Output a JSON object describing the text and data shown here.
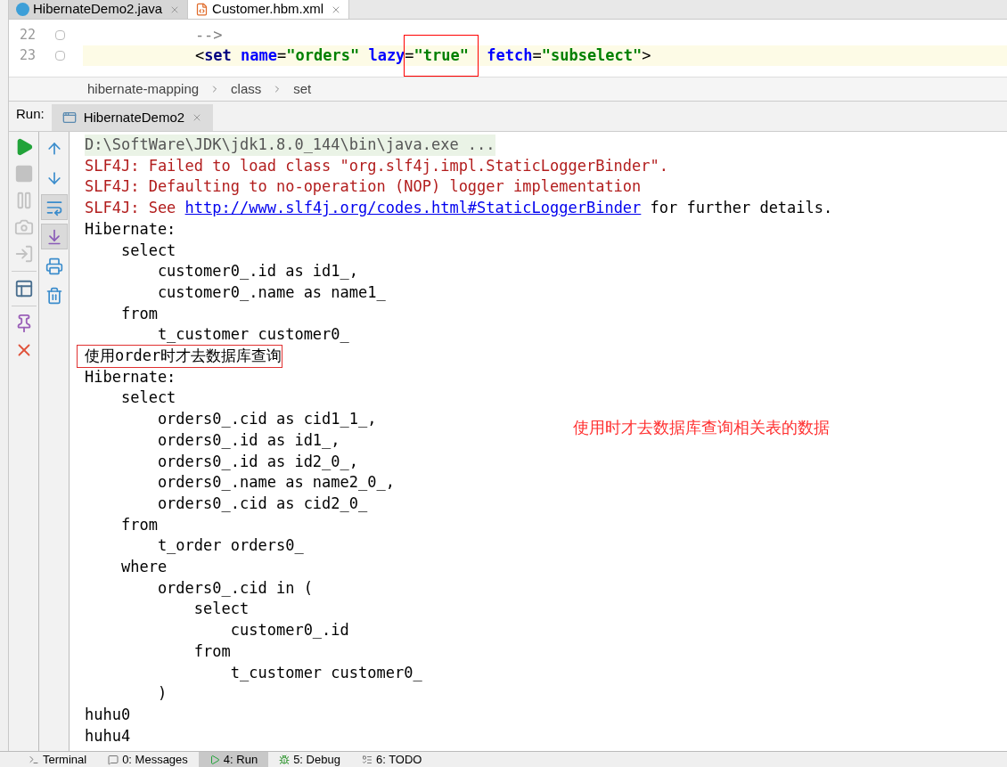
{
  "editor_tabs": [
    {
      "label": "HibernateDemo2.java",
      "kind": "java",
      "selected": false
    },
    {
      "label": "Customer.hbm.xml",
      "kind": "xml",
      "selected": true
    }
  ],
  "editor": {
    "lines": [
      {
        "number": "22",
        "current": false,
        "tokens": [
          {
            "kind": "comment",
            "text": "        -->"
          }
        ]
      },
      {
        "number": "23",
        "current": true,
        "tokens": [
          {
            "kind": "plain",
            "text": "        <"
          },
          {
            "kind": "tag",
            "text": "set"
          },
          {
            "kind": "attr",
            "text": " name"
          },
          {
            "kind": "plain",
            "text": "="
          },
          {
            "kind": "value",
            "text": "\"orders\""
          },
          {
            "kind": "attr",
            "text": " lazy"
          },
          {
            "kind": "group",
            "boxed": true,
            "tokens": [
              {
                "kind": "plain",
                "text": "="
              },
              {
                "kind": "value",
                "text": "\"true\""
              }
            ]
          },
          {
            "kind": "attr",
            "text": " fetch"
          },
          {
            "kind": "plain",
            "text": "="
          },
          {
            "kind": "value",
            "text": "\"subselect\""
          },
          {
            "kind": "plain",
            "text": ">"
          }
        ]
      }
    ]
  },
  "breadcrumb": [
    "hibernate-mapping",
    "class",
    "set"
  ],
  "run_panel": {
    "label": "Run:",
    "tab": "HibernateDemo2"
  },
  "toolbar_left": [
    {
      "kind": "run",
      "disabled": false
    },
    {
      "kind": "stop",
      "disabled": true
    },
    {
      "kind": "pause",
      "disabled": true
    },
    {
      "kind": "camera",
      "disabled": true
    },
    {
      "kind": "exit",
      "disabled": true
    },
    {
      "kind": "layout",
      "disabled": false
    },
    {
      "kind": "pin",
      "disabled": false
    },
    {
      "kind": "close",
      "disabled": false
    }
  ],
  "toolbar_right": [
    {
      "kind": "up",
      "on": false
    },
    {
      "kind": "down",
      "on": false
    },
    {
      "kind": "wrap",
      "on": true
    },
    {
      "kind": "scroll",
      "on": true
    },
    {
      "kind": "print",
      "on": false
    },
    {
      "kind": "trash",
      "on": false
    }
  ],
  "console": [
    {
      "kind": "command",
      "text": "D:\\SoftWare\\JDK\\jdk1.8.0_144\\bin\\java.exe ..."
    },
    {
      "kind": "error",
      "text": "SLF4J: Failed to load class \"org.slf4j.impl.StaticLoggerBinder\"."
    },
    {
      "kind": "error",
      "text": "SLF4J: Defaulting to no-operation (NOP) logger implementation"
    },
    {
      "kind": "link",
      "text": "SLF4J: See ",
      "link": "http://www.slf4j.org/codes.html#StaticLoggerBinder",
      "after": " for further details."
    },
    {
      "kind": "output",
      "text": "Hibernate: "
    },
    {
      "kind": "output",
      "text": "    select"
    },
    {
      "kind": "output",
      "text": "        customer0_.id as id1_,"
    },
    {
      "kind": "output",
      "text": "        customer0_.name as name1_ "
    },
    {
      "kind": "output",
      "text": "    from"
    },
    {
      "kind": "output",
      "text": "        t_customer customer0_"
    },
    {
      "kind": "output",
      "text": "使用order时才去数据库查询",
      "boxed": true
    },
    {
      "kind": "output",
      "text": "Hibernate: "
    },
    {
      "kind": "output",
      "text": "    select"
    },
    {
      "kind": "output",
      "text": "        orders0_.cid as cid1_1_,"
    },
    {
      "kind": "output",
      "text": "        orders0_.id as id1_,"
    },
    {
      "kind": "output",
      "text": "        orders0_.id as id2_0_,"
    },
    {
      "kind": "output",
      "text": "        orders0_.name as name2_0_,"
    },
    {
      "kind": "output",
      "text": "        orders0_.cid as cid2_0_ "
    },
    {
      "kind": "output",
      "text": "    from"
    },
    {
      "kind": "output",
      "text": "        t_order orders0_ "
    },
    {
      "kind": "output",
      "text": "    where"
    },
    {
      "kind": "output",
      "text": "        orders0_.cid in ("
    },
    {
      "kind": "output",
      "text": "            select"
    },
    {
      "kind": "output",
      "text": "                customer0_.id "
    },
    {
      "kind": "output",
      "text": "            from"
    },
    {
      "kind": "output",
      "text": "                t_customer customer0_"
    },
    {
      "kind": "output",
      "text": "        )"
    },
    {
      "kind": "output",
      "text": "huhu0"
    },
    {
      "kind": "output",
      "text": "huhu4"
    }
  ],
  "annotation": "使用时才去数据库查询相关表的数据",
  "bottom_tabs": [
    {
      "label": "Terminal",
      "kind": "terminal",
      "selected": false
    },
    {
      "label": "0: Messages",
      "kind": "messages",
      "selected": false
    },
    {
      "label": "4: Run",
      "kind": "run",
      "selected": true
    },
    {
      "label": "5: Debug",
      "kind": "debug",
      "selected": false
    },
    {
      "label": "6: TODO",
      "kind": "todo",
      "selected": false
    }
  ]
}
